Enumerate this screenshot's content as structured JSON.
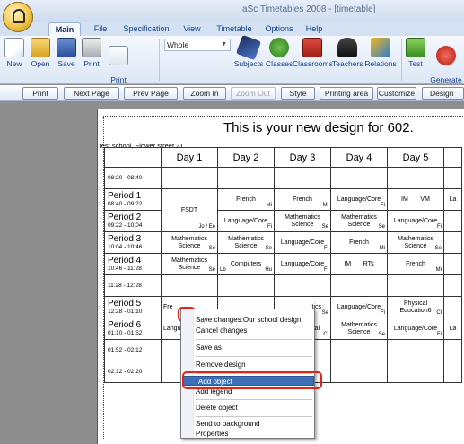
{
  "window": {
    "title": "aSc Timetables 2008  - [timetable]"
  },
  "ribbon_tabs": [
    "Main",
    "File",
    "Specification",
    "View",
    "Timetable",
    "Options",
    "Help"
  ],
  "ribbon": {
    "new": "New",
    "open": "Open",
    "save": "Save",
    "print": "Print",
    "print_preview": "Print\npreview",
    "dropdown_value": "Whole",
    "subjects": "Subjects",
    "classes": "Classes",
    "classrooms": "Classrooms",
    "teachers": "Teachers",
    "relations": "Relations",
    "test": "Test",
    "generate": "Generate\nnew"
  },
  "print_toolbar": {
    "print": "Print",
    "next_page": "Next Page",
    "prev_page": "Prev Page",
    "zoom_in": "Zoom In",
    "zoom_out": "Zoom Out",
    "style": "Style",
    "printing_area": "Printing area",
    "customize": "Customize",
    "design": "Design"
  },
  "page": {
    "title": "This is your new design for 602.",
    "school": "Test school, Flower street 21",
    "days": [
      "Day 1",
      "Day 2",
      "Day 3",
      "Day 4",
      "Day 5"
    ]
  },
  "timetable": {
    "rows": [
      {
        "name": "",
        "time": "08:20 - 08:40"
      },
      {
        "name": "Period 1",
        "time": "08:40 - 09:22"
      },
      {
        "name": "Period 2",
        "time": "09:22 - 10:04"
      },
      {
        "name": "Period 3",
        "time": "10:04 - 10:46"
      },
      {
        "name": "Period 4",
        "time": "10:46 - 11:28"
      },
      {
        "name": "",
        "time": "11:28 - 12:28"
      },
      {
        "name": "Period 5",
        "time": "12:28 - 01:10"
      },
      {
        "name": "Period 6",
        "time": "01:10 - 01:52"
      },
      {
        "name": "",
        "time": "01:52 - 02:12"
      },
      {
        "name": "",
        "time": "02:12 - 02:20"
      }
    ],
    "cells": {
      "p1": [
        "FSDT",
        "French",
        "French",
        "Language/Core",
        "IM       VM"
      ],
      "p1_teacher": [
        "",
        "Mi",
        "Mi",
        "Fi",
        ""
      ],
      "p2": [
        "",
        "Language/Core",
        "Mathematics\nScience",
        "Mathematics\nScience",
        "Language/Core"
      ],
      "p2_teacher": [
        "Jo / Ee",
        "Fi",
        "Se",
        "Se",
        "Fi"
      ],
      "p3": [
        "Mathematics\nScience",
        "Mathematics\nScience",
        "Language/Core",
        "French",
        "Mathematics\nScience"
      ],
      "p3_teacher": [
        "Se",
        "Se",
        "Fi",
        "Mi",
        "Se"
      ],
      "p4": [
        "Mathematics\nScience",
        "Computers",
        "Language/Core",
        "IM       RTs",
        "French"
      ],
      "p4_teacher": [
        "Se",
        "Hu",
        "Fi",
        "",
        "Mi"
      ],
      "p4_left": [
        "",
        "Lb",
        "",
        "",
        ""
      ],
      "p5": [
        "Fre",
        "",
        "tics",
        "Language/Core",
        "Physical\nEducation6"
      ],
      "p5_teacher": [
        "",
        "",
        "Se",
        "Fi",
        "Cl"
      ],
      "p6": [
        "Langu",
        "",
        "al",
        "Mathematics\nScience",
        "Language/Core"
      ],
      "p6_teacher": [
        "",
        "",
        "Cl",
        "Se",
        "Fi"
      ]
    }
  },
  "context_menu": {
    "items": [
      "Save changes:Our school design",
      "Cancel changes",
      "Save as",
      "Remove design",
      "Add object",
      "Add legend",
      "Delete object",
      "Send to background",
      "Properties"
    ]
  }
}
